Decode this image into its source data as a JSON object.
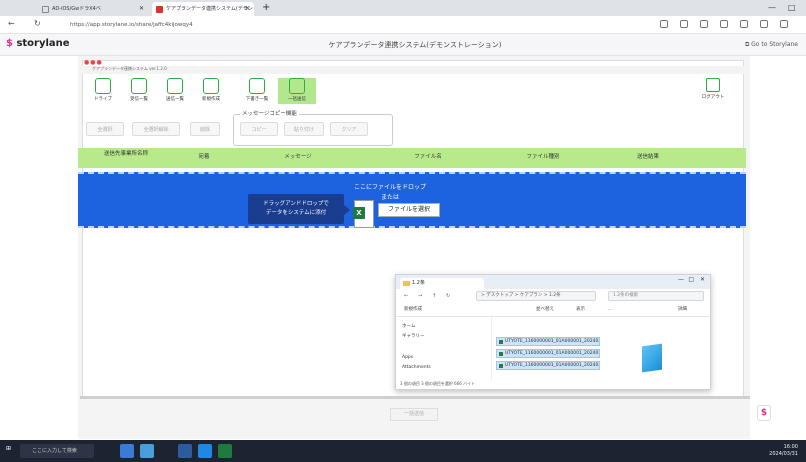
{
  "browser": {
    "tab_inactive": "AD-iOS/GwドラX4ベ",
    "tab_active": "ケアプランデータ連携システム(デモン",
    "new_tab": "+",
    "url": "https://app.storylane.io/share/jaffc4kijowqy4",
    "win_min": "—",
    "win_max": "□"
  },
  "storylane": {
    "logo": "storylane",
    "title": "ケアプランデータ連携システム(デモンストレーション)",
    "goto": "Go to Storylane"
  },
  "app": {
    "inner_title": "ケアプランデータ連携システム ver.1.2.0",
    "toolbar": [
      {
        "label": "ドライブ"
      },
      {
        "label": "受信一覧"
      },
      {
        "label": "送信一覧"
      },
      {
        "label": "新規作成"
      },
      {
        "label": "下書き一覧"
      },
      {
        "label": "一括送信"
      }
    ],
    "logout": "ログアウト",
    "buttons": {
      "select_all": "全選択",
      "deselect_all": "全選択解除",
      "delete": "削除",
      "copy": "コピー",
      "paste": "貼り付け",
      "clear": "クリア"
    },
    "copy_group_label": "メッセージコピー機能",
    "columns": [
      "送信先事業所名称",
      "宛着",
      "メッセージ",
      "ファイル名",
      "ファイル種別",
      "送信結果"
    ],
    "drop_line1": "ここにファイルをドロップ",
    "drop_line2": "または",
    "choose_file": "ファイルを選択",
    "tooltip_line1": "ドラッグアンドドロップで",
    "tooltip_line2": "データをシステムに添付",
    "bulk_send": "一括送信"
  },
  "explorer": {
    "tab_title": "1.2条",
    "breadcrumb": "> デスクトップ > ケアプラン > 1.2条",
    "search": "1.2条の検索",
    "toolbar": [
      "新規作成",
      "並べ替え",
      "表示",
      "...",
      "詳細"
    ],
    "sidebar": [
      "ホーム",
      "ギャラリー",
      "Apps",
      "Attachments"
    ],
    "files": [
      "UTYOTE_1160000001_01A000001_2024031215...",
      "UTYOTE_1160000001_01A000001_2024031215...",
      "UTYOTE_1160000001_01A000001_2024031215..."
    ],
    "status": "3 個の項目  3 個の項目を選択  666 バイト"
  },
  "taskbar": {
    "search": "ここに入力して検索",
    "time": "16:00",
    "date": "2024/03/31"
  }
}
